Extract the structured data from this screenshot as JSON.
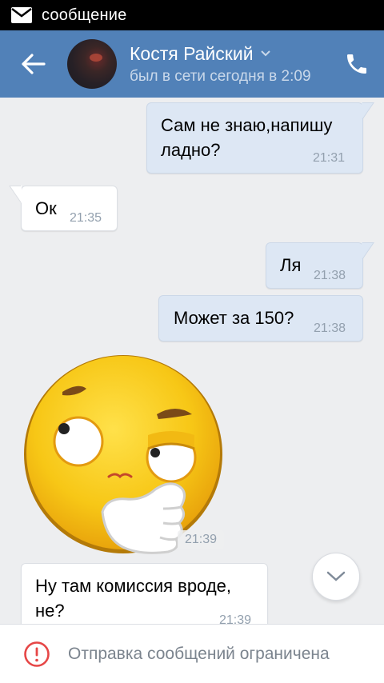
{
  "status_bar": {
    "notification_text": "сообщение",
    "icon": "mail-icon"
  },
  "header": {
    "back_icon": "arrow-left-icon",
    "contact_name": "Костя Райский",
    "last_seen": "был в сети сегодня в 2:09",
    "call_icon": "phone-icon",
    "accent_color": "#5181b8"
  },
  "messages": [
    {
      "direction": "out",
      "text_line1": "Сам не знаю,напишу",
      "text_line2": "ладно?",
      "time": "21:31"
    },
    {
      "direction": "in",
      "text": "Ок",
      "time": "21:35"
    },
    {
      "direction": "out",
      "text": "Ля",
      "time": "21:38"
    },
    {
      "direction": "out",
      "text": "Может за 150?",
      "time": "21:38"
    },
    {
      "direction": "in",
      "type": "sticker",
      "sticker": "thinking-face-sticker",
      "time": "21:39"
    },
    {
      "direction": "in",
      "text_line1": "Ну там комиссия вроде,",
      "text_line2": "не?",
      "time": "21:39"
    }
  ],
  "scroll_down_icon": "chevron-down-icon",
  "footer": {
    "icon": "alert-circle-icon",
    "text": "Отправка сообщений ограничена",
    "alert_color": "#e64646"
  }
}
